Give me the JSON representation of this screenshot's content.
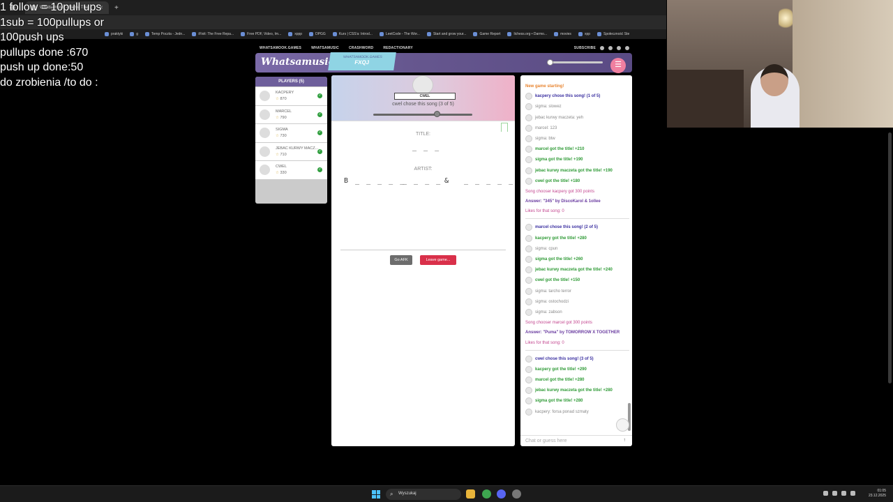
{
  "browser": {
    "active_tab": "Whatsamusic - Name That",
    "bookmarks": [
      "praktyki",
      "g",
      "Temp Poczta - Jedn...",
      "iFixit: The Free Repa...",
      "Free PDF, Video, Im...",
      "xppp",
      "DPGG",
      "Kurs | CSS'a: Introd...",
      "LeetCode - The Wor...",
      "Start and grow your...",
      "Game Report",
      "lichess.org • Darmo...",
      "movies",
      "xpp",
      "Społeczność Ste"
    ]
  },
  "overlay": [
    "1 follow = 10pull ups",
    "1sub = 100pullups or",
    "100push ups",
    "pullups done :670",
    "push up done:50",
    "do zrobienia /to do :"
  ],
  "site": {
    "nav": [
      "WHATSAMOOK.GAMES",
      "WHATSAMUSIC",
      "CRASHWORD",
      "REDACTIONARY"
    ],
    "subscribe": "SUBSCRIBE",
    "logo": "Whatsamusic",
    "room_site": "WHATSAMOOK.GAMES",
    "room_code": "FXQJ",
    "menu_icon": "☰"
  },
  "players": {
    "header": "PLAYERS (5)",
    "list": [
      {
        "name": "KACPERY",
        "score": "870"
      },
      {
        "name": "MARCEL",
        "score": "790"
      },
      {
        "name": "SIGMA",
        "score": "730"
      },
      {
        "name": "JEBAC KURWY MACZ...",
        "score": "710"
      },
      {
        "name": "CWEL",
        "score": "330"
      }
    ],
    "star": "☆",
    "check": "✓"
  },
  "game": {
    "chooser_name": "CWEL",
    "chose_text": "cwel chose this song (3 of 5)",
    "title_label": "TITLE:",
    "title_hint": "_ _ _",
    "artist_label": "ARTIST:",
    "artist_hint_1": "B _ _ _ _ _",
    "artist_hint_2": "_ _ _ _",
    "artist_amp": "&",
    "artist_hint_3": "_ _ _ _ _",
    "afk_button": "Go AFK",
    "leave_button": "Leave game..."
  },
  "chat": {
    "messages": [
      {
        "type": "plain",
        "cls": "c-orange",
        "text": "New game starting!"
      },
      {
        "type": "av",
        "cls": "c-blue",
        "text": "kacpery chose this song! (1 of 5)"
      },
      {
        "type": "av",
        "cls": "c-gray",
        "text": "sigma: slowez"
      },
      {
        "type": "av",
        "cls": "c-gray",
        "text": "jebac kurwy maczeta: yeh"
      },
      {
        "type": "av",
        "cls": "c-gray",
        "text": "marcel: 123"
      },
      {
        "type": "av",
        "cls": "c-gray",
        "text": "sigma: btw"
      },
      {
        "type": "av",
        "cls": "c-green",
        "text": "marcel got the title! +210"
      },
      {
        "type": "av",
        "cls": "c-green",
        "text": "sigma got the title! +190"
      },
      {
        "type": "av",
        "cls": "c-green",
        "text": "jebac kurwy maczeta got the title! +190"
      },
      {
        "type": "av",
        "cls": "c-green",
        "text": "cwel got the title! +180"
      },
      {
        "type": "plain",
        "cls": "c-pink",
        "text": "Song chooser kacpery got 300 points"
      },
      {
        "type": "plain",
        "cls": "c-purple",
        "text": "Answer: \"345\" by DiscoKarol & 1ollee"
      },
      {
        "type": "plain",
        "cls": "c-pink",
        "text": "Likes for that song: 0"
      },
      {
        "type": "sep"
      },
      {
        "type": "av",
        "cls": "c-blue",
        "text": "marcel chose this song! (2 of 5)"
      },
      {
        "type": "av",
        "cls": "c-green",
        "text": "kacpery got the title! +280"
      },
      {
        "type": "av",
        "cls": "c-gray",
        "text": "sigma: cpun"
      },
      {
        "type": "av",
        "cls": "c-green",
        "text": "sigma got the title! +260"
      },
      {
        "type": "av",
        "cls": "c-green",
        "text": "jebac kurwy maczeta got the title! +240"
      },
      {
        "type": "av",
        "cls": "c-green",
        "text": "cwel got the title! +150"
      },
      {
        "type": "av",
        "cls": "c-gray",
        "text": "sigma: tarcho terror"
      },
      {
        "type": "av",
        "cls": "c-gray",
        "text": "sigma: ostochodzi"
      },
      {
        "type": "av",
        "cls": "c-gray",
        "text": "sigma: zabson"
      },
      {
        "type": "plain",
        "cls": "c-pink",
        "text": "Song chooser marcel got 300 points"
      },
      {
        "type": "plain",
        "cls": "c-purple",
        "text": "Answer: \"Puma\" by TOMORROW X TOGETHER"
      },
      {
        "type": "plain",
        "cls": "c-pink",
        "text": "Likes for that song: 0"
      },
      {
        "type": "sep"
      },
      {
        "type": "av",
        "cls": "c-blue",
        "text": "cwel chose this song! (3 of 5)"
      },
      {
        "type": "av",
        "cls": "c-green",
        "text": "kacpery got the title! +290"
      },
      {
        "type": "av",
        "cls": "c-green",
        "text": "marcel got the title! +280"
      },
      {
        "type": "av",
        "cls": "c-green",
        "text": "jebac kurwy maczeta got the title! +280"
      },
      {
        "type": "av",
        "cls": "c-green",
        "text": "sigma got the title! +280"
      },
      {
        "type": "av",
        "cls": "c-gray",
        "text": "kacpery: forsa ponad szmaty"
      }
    ],
    "input_placeholder": "Chat or guess here",
    "send_icon": "↑"
  },
  "taskbar": {
    "search_placeholder": "Wyszukaj",
    "time": "01:05",
    "date": "23.12.2025"
  }
}
